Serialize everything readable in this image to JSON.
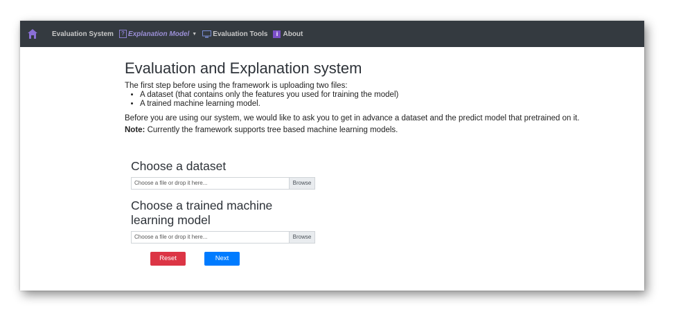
{
  "navbar": {
    "brand": "Evaluation System",
    "explanation_model": "Explanation Model",
    "evaluation_tools": "Evaluation Tools",
    "about": "About",
    "icons": {
      "home": "home-icon",
      "question": "question-icon",
      "monitor": "monitor-icon",
      "info": "info-icon"
    },
    "colors": {
      "bar": "#343a40",
      "accent": "#7b4fc8"
    }
  },
  "main": {
    "title": "Evaluation and Explanation system",
    "intro": "The first step before using the framework is uploading two files:",
    "requirements": [
      "A dataset (that contains only the features you used for training the model)",
      "A trained machine learning model."
    ],
    "paragraph": "Before you are using our system, we would like to ask you to get in advance a dataset and the predict model that pretrained on it.",
    "note_label": "Note:",
    "note_text": " Currently the framework supports tree based machine learning models."
  },
  "dataset_upload": {
    "title": "Choose a dataset",
    "placeholder": "Choose a file or drop it here...",
    "browse": "Browse"
  },
  "model_upload": {
    "title_line1": "Choose a trained machine",
    "title_line2": "learning model",
    "placeholder": "Choose a file or drop it here...",
    "browse": "Browse"
  },
  "actions": {
    "reset": "Reset",
    "next": "Next",
    "reset_color": "#dc3545",
    "next_color": "#007bff"
  }
}
